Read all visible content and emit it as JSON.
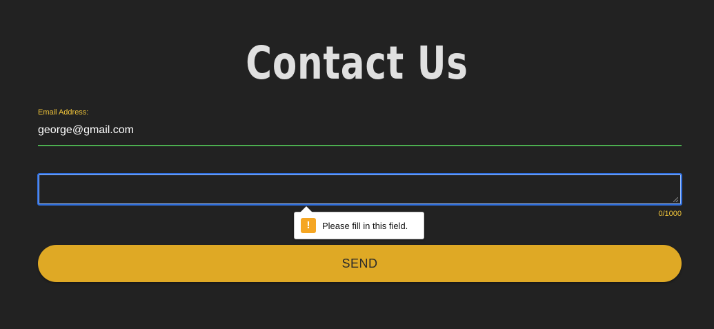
{
  "page": {
    "title": "Contact Us"
  },
  "email": {
    "label": "Email Address:",
    "value": "george@gmail.com"
  },
  "message": {
    "value": "",
    "char_count": "0/1000"
  },
  "validation": {
    "icon": "warning-icon",
    "glyph": "!",
    "message": "Please fill in this field."
  },
  "send": {
    "label": "SEND"
  },
  "colors": {
    "background": "#222222",
    "accent": "#f0c43a",
    "button": "#dfa925",
    "valid_underline": "#4caf50",
    "focus_ring": "#2f6fe0"
  }
}
